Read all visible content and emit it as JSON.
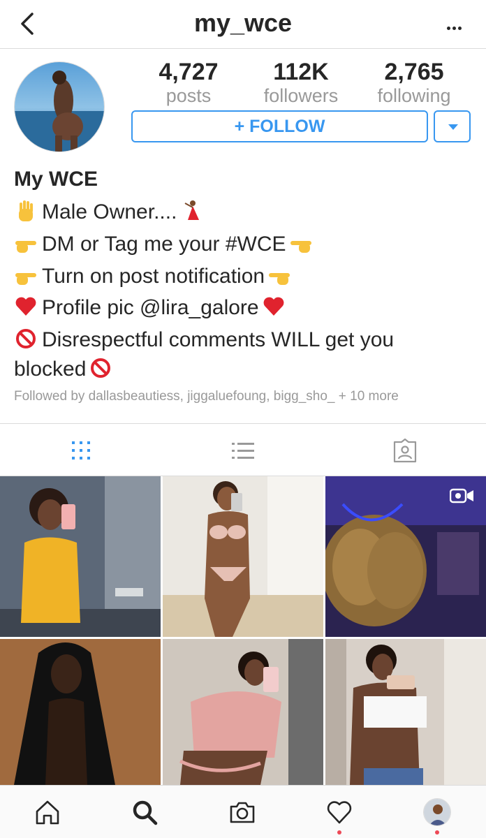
{
  "header": {
    "username": "my_wce"
  },
  "profile": {
    "posts": {
      "value": "4,727",
      "label": "posts"
    },
    "followers": {
      "value": "112K",
      "label": "followers"
    },
    "following": {
      "value": "2,765",
      "label": "following"
    },
    "follow_button": "+ FOLLOW",
    "name": "My WCE",
    "bio_lines": [
      "Male Owner....",
      "DM or Tag me your #WCE",
      "Turn on post notification",
      "Profile pic @lira_galore",
      "Disrespectful comments WILL get you",
      "blocked"
    ],
    "followed_by": "Followed by dallasbeautiess, jiggaluefoung, bigg_sho_ + 10 more"
  },
  "icons": {
    "back": "chevron-left-icon",
    "more": "ellipsis-icon",
    "emoji": [
      "raised-hand",
      "dancer",
      "backhand-index-pointing-right",
      "backhand-index-pointing-left",
      "red-heart",
      "prohibited"
    ],
    "tabs": [
      "grid-icon",
      "list-icon",
      "tagged-icon"
    ],
    "bottom_nav": [
      "home-icon",
      "search-icon",
      "camera-icon",
      "heart-icon",
      "profile-icon"
    ]
  },
  "colors": {
    "accent": "#3897f0",
    "notification": "#ed4956",
    "muted": "#999999"
  }
}
